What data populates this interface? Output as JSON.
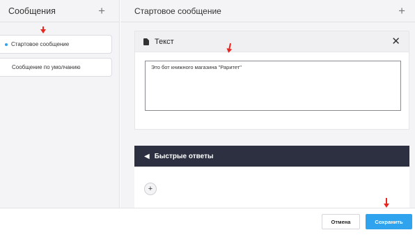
{
  "sidebar": {
    "title": "Сообщения",
    "add_icon": "+",
    "items": [
      {
        "label": "Стартовое сообщение",
        "active": true
      },
      {
        "label": "Сообщение по умолчанию",
        "active": false
      }
    ]
  },
  "main": {
    "title": "Стартовое сообщение",
    "add_icon": "+",
    "text_card": {
      "title": "Текст",
      "close_icon": "✕",
      "value": "Это бот книжного магазина \"Раритет\""
    },
    "quick_replies": {
      "title": "Быстрые ответы",
      "reply_icon": "◀",
      "add_icon": "+"
    }
  },
  "footer": {
    "cancel_label": "Отмена",
    "save_label": "Сохранить"
  },
  "colors": {
    "accent": "#2fa3ee",
    "dark_header": "#2d3040",
    "annotation_arrow": "#e8251e"
  }
}
